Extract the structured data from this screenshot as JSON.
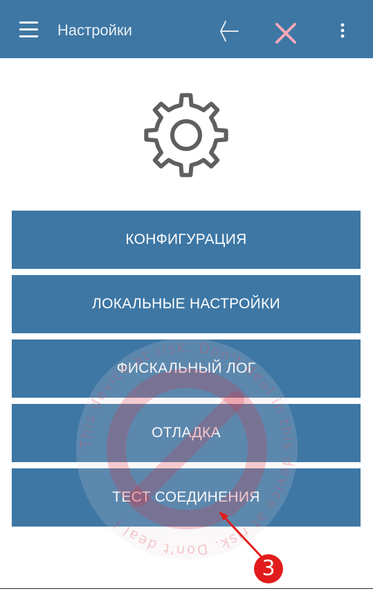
{
  "appbar": {
    "title": "Настройки",
    "icons": [
      "menu-icon",
      "back-icon",
      "close-icon",
      "more-icon"
    ],
    "background": "#3e77a4",
    "close_color": "#f6a9b8"
  },
  "header_icon": "gear-icon",
  "menu": {
    "items": [
      {
        "label": "КОНФИГУРАЦИЯ"
      },
      {
        "label": "ЛОКАЛЬНЫЕ НАСТРОЙКИ"
      },
      {
        "label": "ФИСКАЛЬНЫЙ ЛОГ"
      },
      {
        "label": "ОТЛАДКА"
      },
      {
        "label": "ТЕСТ СОЕДИНЕНИЯ"
      }
    ]
  },
  "watermark": {
    "text": "This device at risk. Don't deal in this device at risk. Don't deal i"
  },
  "annotation": {
    "step": "3",
    "color": "#e21c1c"
  }
}
